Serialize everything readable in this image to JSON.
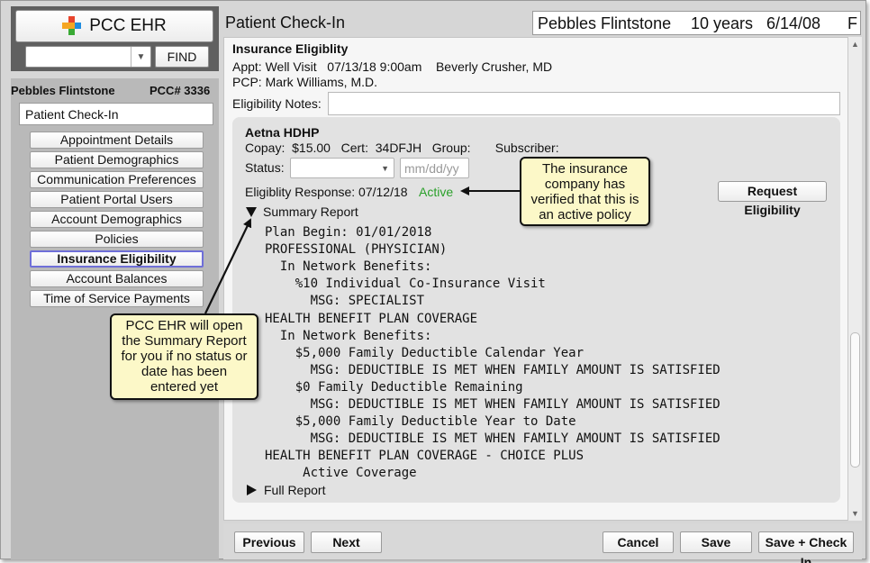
{
  "brand": {
    "name": "PCC EHR",
    "find_label": "FIND",
    "logo_colors": [
      "#e8442c",
      "#f5a623",
      "#1f8de0",
      "#3aaa35"
    ]
  },
  "sidebar": {
    "patient_name": "Pebbles Flintstone",
    "patient_id": "PCC# 3336",
    "current_page": "Patient Check-In",
    "items": [
      {
        "label": "Appointment Details",
        "active": false
      },
      {
        "label": "Patient Demographics",
        "active": false
      },
      {
        "label": "Communication Preferences",
        "active": false
      },
      {
        "label": "Patient Portal Users",
        "active": false
      },
      {
        "label": "Account Demographics",
        "active": false
      },
      {
        "label": "Policies",
        "active": false
      },
      {
        "label": "Insurance Eligibility",
        "active": true
      },
      {
        "label": "Account Balances",
        "active": false
      },
      {
        "label": "Time of Service Payments",
        "active": false
      }
    ]
  },
  "header": {
    "page_title": "Patient Check-In",
    "patient_name": "Pebbles Flintstone",
    "age": "10 years",
    "dob": "6/14/08",
    "sex": "F"
  },
  "eligibility": {
    "section_title": "Insurance Eligiblity",
    "appt_line": "Appt: Well Visit   07/13/18 9:00am    Beverly Crusher, MD",
    "pcp_line": "PCP: Mark Williams, M.D.",
    "notes_label": "Eligibility Notes:",
    "notes_value": "",
    "plan_name": "Aetna HDHP",
    "plan_details": "Copay:  $15.00   Cert:  34DFJH   Group:       Subscriber:",
    "status_label": "Status:",
    "status_value": "",
    "date_placeholder": "mm/dd/yy",
    "response_label": "Eligiblity Response:  07/12/18",
    "response_status": "Active",
    "request_button": "Request Eligibility",
    "summary_label": "Summary Report",
    "full_label": "Full Report",
    "summary_lines": [
      "Plan Begin: 01/01/2018",
      "PROFESSIONAL (PHYSICIAN)",
      "  In Network Benefits:",
      "    %10 Individual Co-Insurance Visit",
      "      MSG: SPECIALIST",
      "HEALTH BENEFIT PLAN COVERAGE",
      "  In Network Benefits:",
      "    $5,000 Family Deductible Calendar Year",
      "      MSG: DEDUCTIBLE IS MET WHEN FAMILY AMOUNT IS SATISFIED",
      "    $0 Family Deductible Remaining",
      "      MSG: DEDUCTIBLE IS MET WHEN FAMILY AMOUNT IS SATISFIED",
      "    $5,000 Family Deductible Year to Date",
      "      MSG: DEDUCTIBLE IS MET WHEN FAMILY AMOUNT IS SATISFIED",
      "HEALTH BENEFIT PLAN COVERAGE - CHOICE PLUS",
      "     Active Coverage"
    ]
  },
  "footer": {
    "previous": "Previous",
    "next": "Next",
    "cancel": "Cancel",
    "save": "Save",
    "save_checkin": "Save + Check In"
  },
  "callouts": {
    "active_policy": "The insurance\ncompany has\nverified that this is\nan active policy",
    "summary_open": "PCC EHR will open\nthe Summary Report\nfor you if no status or\ndate has been\nentered yet"
  }
}
